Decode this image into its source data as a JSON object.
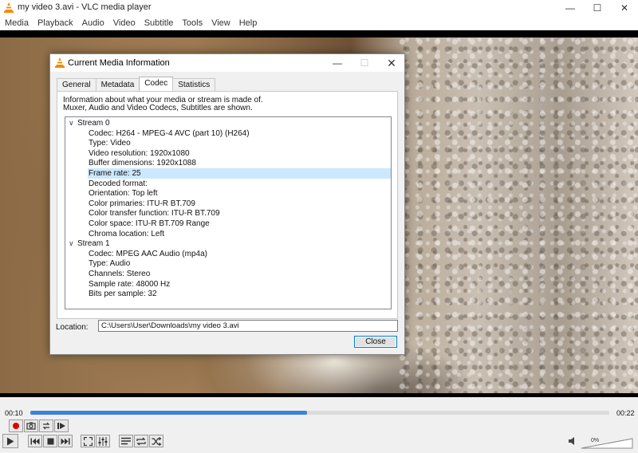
{
  "window": {
    "title": "my video 3.avi - VLC media player",
    "minimize": "—",
    "maximize": "☐",
    "close": "✕"
  },
  "menu": [
    "Media",
    "Playback",
    "Audio",
    "Video",
    "Subtitle",
    "Tools",
    "View",
    "Help"
  ],
  "dialog": {
    "title": "Current Media Information",
    "minimize": "—",
    "maximize": "☐",
    "close": "✕",
    "tabs": [
      "General",
      "Metadata",
      "Codec",
      "Statistics"
    ],
    "active_tab": "Codec",
    "info_line1": "Information about what your media or stream is made of.",
    "info_line2": "Muxer, Audio and Video Codecs, Subtitles are shown.",
    "streams": [
      {
        "label": "Stream 0",
        "chevron": "∨",
        "items": [
          "Codec: H264 - MPEG-4 AVC (part 10) (H264)",
          "Type: Video",
          "Video resolution: 1920x1080",
          "Buffer dimensions: 1920x1088",
          "Frame rate: 25",
          "Decoded format:",
          "Orientation: Top left",
          "Color primaries: ITU-R BT.709",
          "Color transfer function: ITU-R BT.709",
          "Color space: ITU-R BT.709 Range",
          "Chroma location: Left"
        ]
      },
      {
        "label": "Stream 1",
        "chevron": "∨",
        "items": [
          "Codec: MPEG AAC Audio (mp4a)",
          "Type: Audio",
          "Channels: Stereo",
          "Sample rate: 48000 Hz",
          "Bits per sample: 32"
        ]
      }
    ],
    "selected_item": "Frame rate: 25",
    "location_label": "Location:",
    "location_value": "C:\\Users\\User\\Downloads\\my video 3.avi",
    "close_button": "Close"
  },
  "player": {
    "time_current": "00:10",
    "time_total": "00:22",
    "progress": 0.478,
    "volume_text": "0%",
    "accent_color": "#3c82d9",
    "record_color": "#e00000"
  }
}
